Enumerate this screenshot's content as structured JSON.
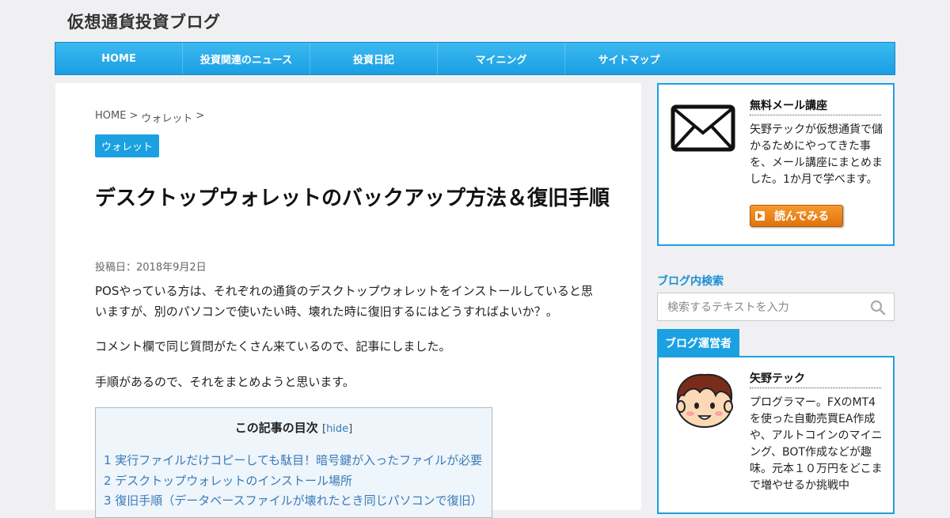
{
  "site": {
    "title": "仮想通貨投資ブログ"
  },
  "nav": {
    "items": [
      "HOME",
      "投資関連のニュース",
      "投資日記",
      "マイニング",
      "サイトマップ"
    ]
  },
  "breadcrumb": {
    "home": "HOME",
    "sep1": ">",
    "category": "ウォレット",
    "sep2": ">"
  },
  "post": {
    "category_tag": "ウォレット",
    "title": "デスクトップウォレットのバックアップ方法＆復旧手順",
    "date": "投稿日：2018年9月2日",
    "paragraphs": [
      "POSやっている方は、それぞれの通貨のデスクトップウォレットをインストールしていると思いますが、別のパソコンで使いたい時、壊れた時に復旧するにはどうすればよいか？。",
      "コメント欄で同じ質問がたくさん来ているので、記事にしました。",
      "手順があるので、それをまとめようと思います。"
    ]
  },
  "toc": {
    "heading": "この記事の目次",
    "bracket_open": "[",
    "hide": "hide",
    "bracket_close": "]",
    "items": [
      "1 実行ファイルだけコピーしても駄目！暗号鍵が入ったファイルが必要",
      "2 デスクトップウォレットのインストール場所",
      "3 復旧手順（データベースファイルが壊れたとき同じパソコンで復旧）"
    ]
  },
  "sidebar": {
    "mail_widget": {
      "title": "無料メール講座",
      "text": "矢野テックが仮想通貨で儲かるためにやってきた事を、メール講座にまとめました。1か月で学べます。",
      "button": "読んでみる",
      "icon": "envelope-icon"
    },
    "search": {
      "heading": "ブログ内検索",
      "placeholder": "検索するテキストを入力",
      "icon": "search-icon"
    },
    "owner": {
      "tab": "ブログ運営者",
      "name": "矢野テック",
      "bio": "プログラマー。FXのMT4を使った自動売買EA作成や、アルトコインのマイニング、BOT作成などが趣味。元本１０万円をどこまで増やせるか挑戦中"
    }
  },
  "colors": {
    "accent": "#1ba1e2",
    "nav": "#1a9fe3",
    "button": "#e2720c",
    "link": "#3a7ab8",
    "background": "#f0f0f2"
  }
}
